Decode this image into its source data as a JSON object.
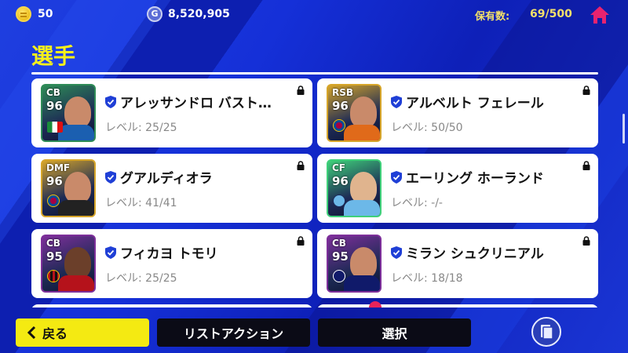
{
  "topbar": {
    "coins": "50",
    "gp": "8,520,905",
    "gp_symbol": "G",
    "hold_label": "保有数:",
    "hold_value": "69/500"
  },
  "page_title": "選手",
  "players": [
    {
      "position": "CB",
      "rating": "96",
      "name": "アレッサンドロ バスト…",
      "level": "レベル: 25/25",
      "border": "#2e8b57",
      "shirt": "#1b5fb0"
    },
    {
      "position": "RSB",
      "rating": "96",
      "name": "アルベルト フェレール",
      "level": "レベル: 50/50",
      "border": "#d6a52a",
      "shirt": "#e06a1a"
    },
    {
      "position": "DMF",
      "rating": "96",
      "name": "グアルディオラ",
      "level": "レベル: 41/41",
      "border": "#d6a52a",
      "shirt": "#222222"
    },
    {
      "position": "CF",
      "rating": "96",
      "name": "エーリング ホーランド",
      "level": "レベル: -/-",
      "border": "#3fd07a",
      "shirt": "#6cb8e8"
    },
    {
      "position": "CB",
      "rating": "95",
      "name": "フィカヨ トモリ",
      "level": "レベル: 25/25",
      "border": "#7d2f9a",
      "shirt": "#b5121b"
    },
    {
      "position": "CB",
      "rating": "95",
      "name": "ミラン シュクリニアル",
      "level": "レベル: 18/18",
      "border": "#7d2f9a",
      "shirt": "#101a6a"
    }
  ],
  "bottom": {
    "back_label": "戻る",
    "list_action_label": "リストアクション",
    "select_label": "選択"
  },
  "colors": {
    "accent_yellow": "#f4ea12",
    "background_blue": "#1027c9",
    "home_icon": "#e8236f",
    "shield_icon": "#1f3fd6"
  }
}
